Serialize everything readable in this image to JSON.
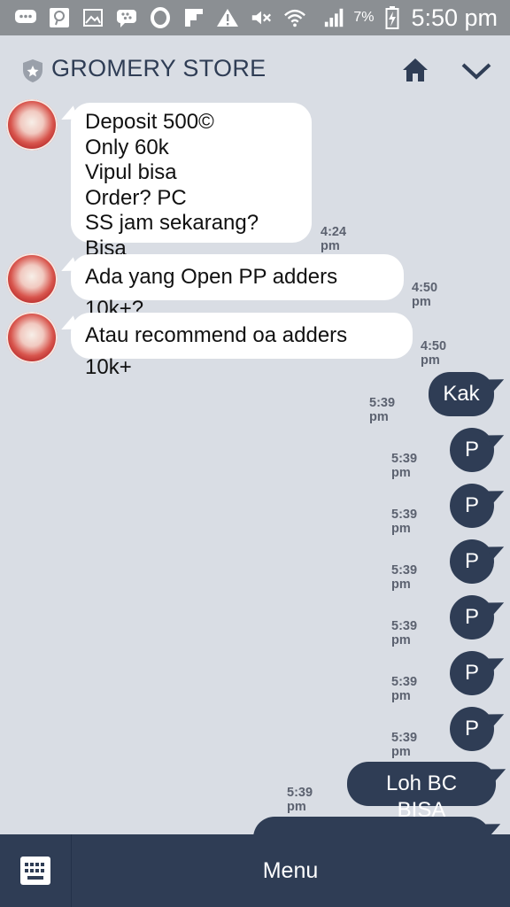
{
  "status_bar": {
    "battery": "7%",
    "time": "5:50 pm",
    "icons": [
      "chat-icon",
      "pinterest-icon",
      "gallery-icon",
      "bbm-icon",
      "opera-icon",
      "flipboard-icon",
      "warning-icon",
      "mute-icon",
      "wifi-icon",
      "signal-icon",
      "battery-icon"
    ]
  },
  "header": {
    "title": "GROMERY STORE",
    "icons": [
      "shield-star-icon",
      "home-icon",
      "chevron-down-icon"
    ]
  },
  "messages": [
    {
      "from": "store",
      "lines": [
        "Deposit 500©",
        "Only 60k",
        "Vipul bisa",
        "Order? PC",
        "SS jam sekarang? Bisa"
      ],
      "time": "4:24 pm"
    },
    {
      "from": "store",
      "text": "Ada yang Open PP adders 10k+?",
      "time": "4:50 pm"
    },
    {
      "from": "store",
      "text": "Atau recommend oa adders 10k+",
      "time": "4:50 pm"
    },
    {
      "from": "me",
      "text": "Kak",
      "time": "5:39 pm"
    },
    {
      "from": "me",
      "text": "P",
      "time": "5:39 pm"
    },
    {
      "from": "me",
      "text": "P",
      "time": "5:39 pm"
    },
    {
      "from": "me",
      "text": "P",
      "time": "5:39 pm"
    },
    {
      "from": "me",
      "text": "P",
      "time": "5:39 pm"
    },
    {
      "from": "me",
      "text": "P",
      "time": "5:39 pm"
    },
    {
      "from": "me",
      "text": "P",
      "time": "5:39 pm"
    },
    {
      "from": "me",
      "text": "Loh BC BISA",
      "time": "5:39 pm"
    }
  ],
  "bottom_bar": {
    "menu_label": "Menu",
    "keyboard_icon": "keyboard-icon"
  },
  "colors": {
    "background": "#d9dde4",
    "outgoing_bubble": "#2f3d55",
    "incoming_bubble": "#ffffff",
    "status_bar": "#8b8f93"
  }
}
